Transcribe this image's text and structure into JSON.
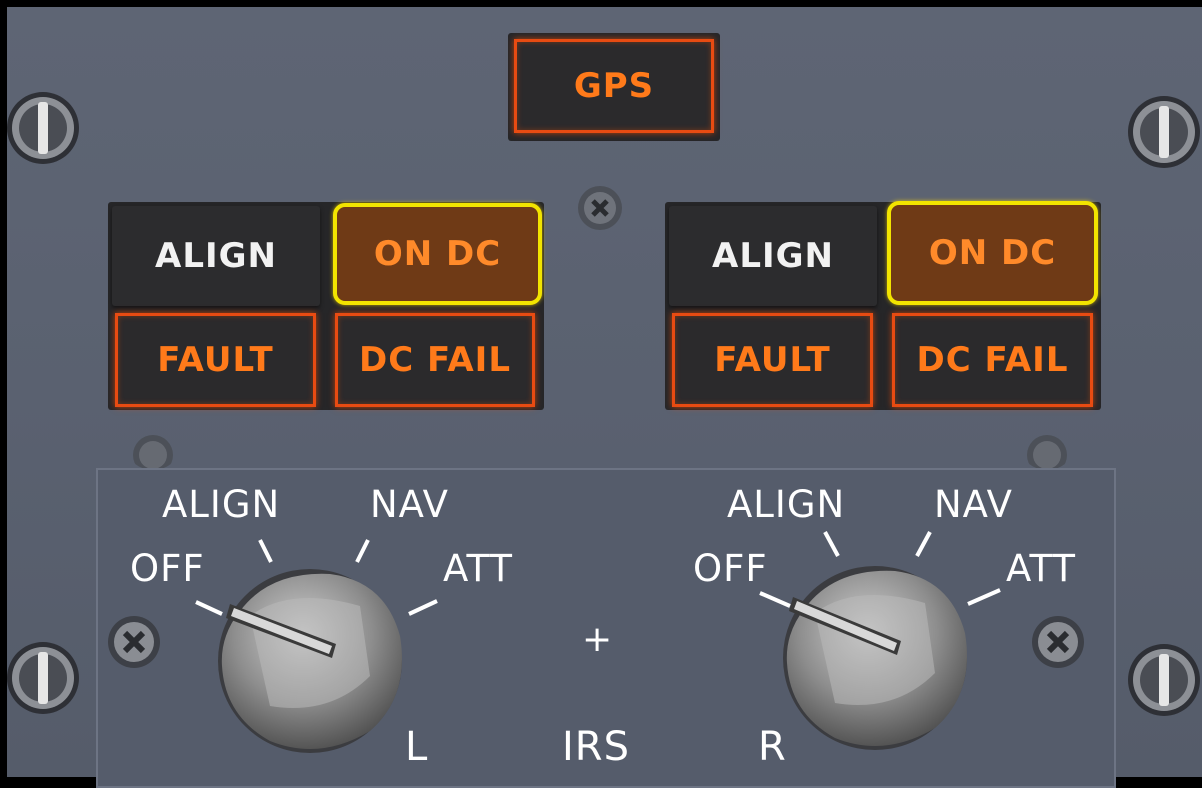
{
  "gps": {
    "label": "GPS"
  },
  "left_lamps": {
    "align": "ALIGN",
    "on_dc": "ON DC",
    "fault": "FAULT",
    "dc_fail": "DC FAIL"
  },
  "right_lamps": {
    "align": "ALIGN",
    "on_dc": "ON DC",
    "fault": "FAULT",
    "dc_fail": "DC FAIL"
  },
  "selector_labels": {
    "off": "OFF",
    "align": "ALIGN",
    "nav": "NAV",
    "att": "ATT"
  },
  "left_selector": {
    "position": "OFF",
    "side": "L"
  },
  "right_selector": {
    "position": "OFF",
    "side": "R"
  },
  "center": {
    "plus": "+",
    "title": "IRS"
  },
  "colors": {
    "amber": "#ff7a1a",
    "on_dc_border": "#f2e400",
    "panel": "#5a6170"
  }
}
